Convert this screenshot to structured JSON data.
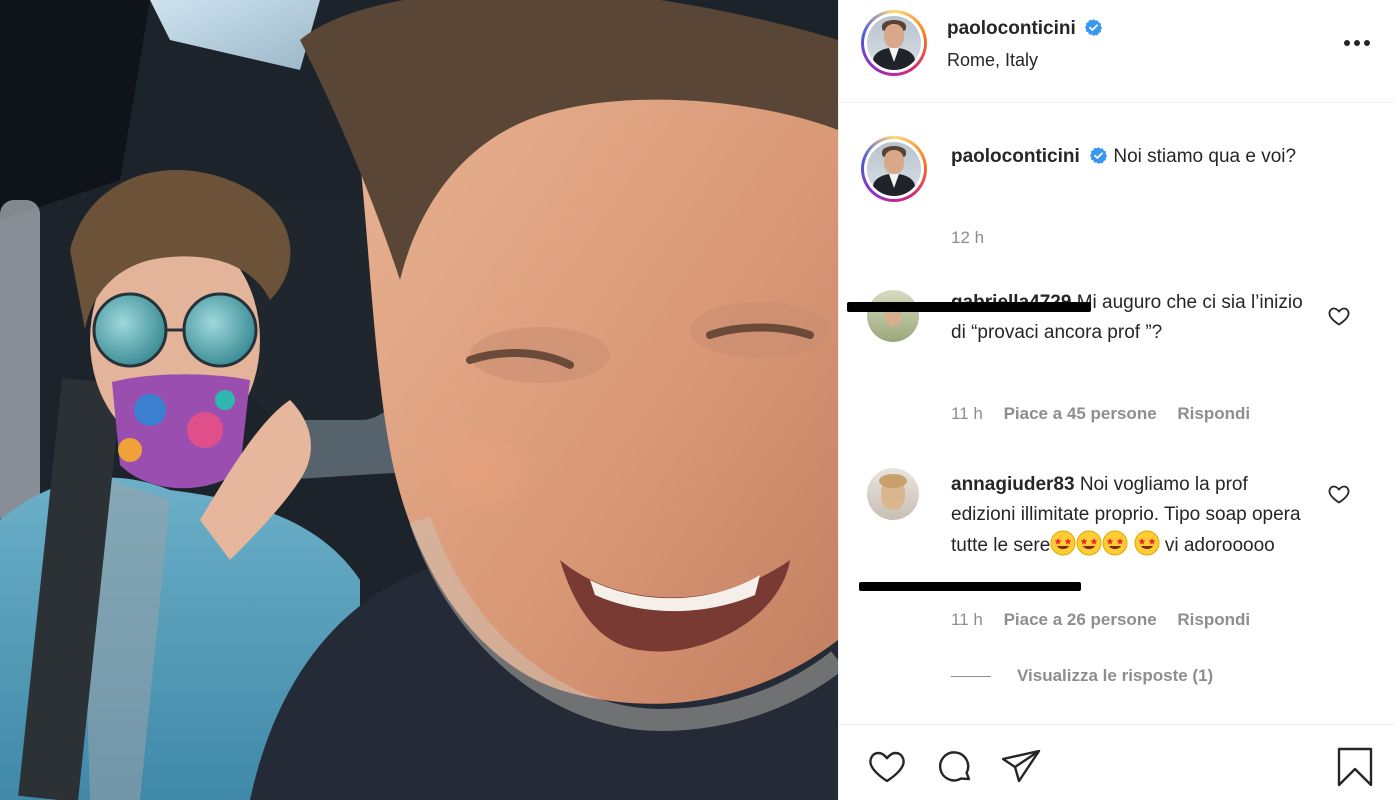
{
  "post": {
    "username": "paoloconticini",
    "verified": true,
    "location": "Rome, Italy",
    "caption": "Noi stiamo qua e voi?",
    "caption_time": "12 h"
  },
  "comments": [
    {
      "username": "gabriella4729",
      "text": "Mi auguro che ci sia l’inizio di “provaci ancora prof ”?",
      "time": "11 h",
      "likes": "Piace a 45 persone",
      "reply": "Rispondi"
    },
    {
      "username": "annagiuder83",
      "text": "Noi vogliamo la prof edizioni illimitate proprio. Tipo soap opera tutte le sere",
      "text_after_emoji": "vi adorooooo",
      "emoji": "star-struck-emoji",
      "time": "11 h",
      "likes": "Piace a 26 persone",
      "reply": "Rispondi",
      "view_replies": "Visualizza le risposte (1)"
    }
  ],
  "icons": {
    "more": "more-options-icon",
    "verified": "verified-badge-icon",
    "like": "heart-icon",
    "comment": "comment-icon",
    "share": "send-icon",
    "save": "bookmark-icon"
  },
  "colors": {
    "verified_blue": "#3897f0",
    "text": "#262626",
    "muted": "#8e8e8e",
    "divider": "#efefef"
  }
}
